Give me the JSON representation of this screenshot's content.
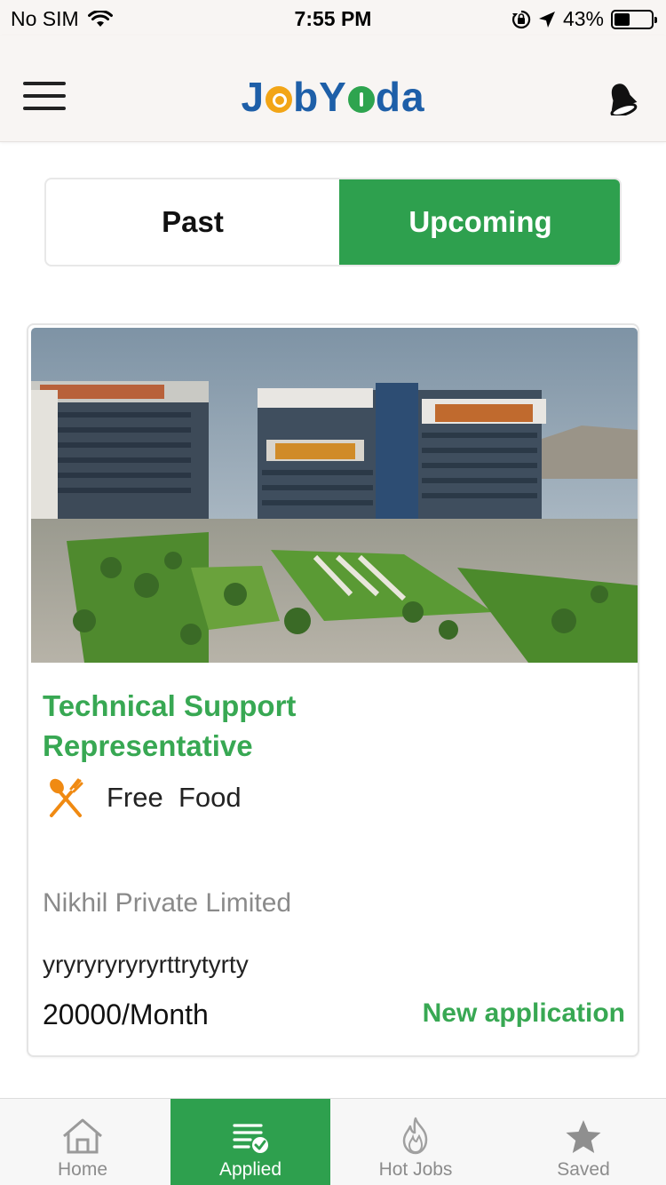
{
  "status_bar": {
    "carrier": "No SIM",
    "time": "7:55 PM",
    "battery_percent": "43%",
    "battery_level": 0.43,
    "icons": [
      "wifi-icon",
      "orientation-lock-icon",
      "location-arrow-icon",
      "battery-icon"
    ]
  },
  "header": {
    "logo_part1": "J",
    "logo_part2": "bY",
    "logo_part3": "da",
    "icons": [
      "menu-icon",
      "bell-icon"
    ]
  },
  "segment": {
    "tabs": [
      {
        "label": "Past",
        "selected": false
      },
      {
        "label": "Upcoming",
        "selected": true
      }
    ]
  },
  "job_card": {
    "title": "Technical Support Representative",
    "perk_label": "Free  Food",
    "perk_icon": "fork-knife-icon",
    "company": "Nikhil Private Limited",
    "description": "yryryryryryrttrytyrty",
    "salary": "20000/Month",
    "status": "New application"
  },
  "tab_bar": {
    "tabs": [
      {
        "label": "Home",
        "icon": "home-icon",
        "active": false
      },
      {
        "label": "Applied",
        "icon": "applied-list-check-icon",
        "active": true
      },
      {
        "label": "Hot Jobs",
        "icon": "flame-icon",
        "active": false
      },
      {
        "label": "Saved",
        "icon": "star-icon",
        "active": false
      }
    ]
  },
  "colors": {
    "accent_green": "#2ea04e",
    "title_green": "#38a853",
    "logo_blue": "#1e5fa8",
    "logo_orange": "#f2a516",
    "perk_orange": "#f08a12"
  }
}
